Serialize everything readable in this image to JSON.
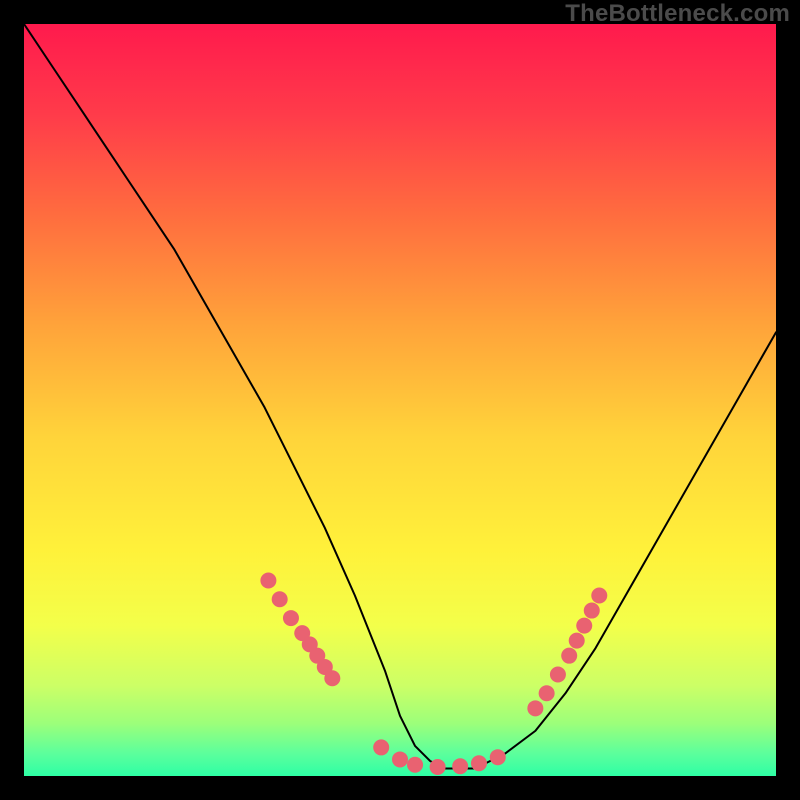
{
  "watermark": "TheBottleneck.com",
  "gradient": {
    "stops": [
      {
        "offset": 0.0,
        "color": "#ff1a4d"
      },
      {
        "offset": 0.12,
        "color": "#ff3b4a"
      },
      {
        "offset": 0.25,
        "color": "#ff6b3f"
      },
      {
        "offset": 0.4,
        "color": "#ffa33a"
      },
      {
        "offset": 0.55,
        "color": "#ffd43a"
      },
      {
        "offset": 0.7,
        "color": "#fff13a"
      },
      {
        "offset": 0.8,
        "color": "#f3ff4a"
      },
      {
        "offset": 0.88,
        "color": "#ccff66"
      },
      {
        "offset": 0.93,
        "color": "#9cff7a"
      },
      {
        "offset": 0.97,
        "color": "#5cff9c"
      },
      {
        "offset": 1.0,
        "color": "#2effa5"
      }
    ]
  },
  "chart_data": {
    "type": "line",
    "title": "",
    "xlabel": "",
    "ylabel": "",
    "xlim": [
      0,
      100
    ],
    "ylim": [
      0,
      100
    ],
    "series": [
      {
        "name": "bottleneck-curve",
        "x": [
          0,
          4,
          8,
          12,
          16,
          20,
          24,
          28,
          32,
          36,
          40,
          44,
          48,
          50,
          52,
          54,
          56,
          58,
          60,
          62,
          64,
          68,
          72,
          76,
          80,
          84,
          88,
          92,
          96,
          100
        ],
        "y": [
          100,
          94,
          88,
          82,
          76,
          70,
          63,
          56,
          49,
          41,
          33,
          24,
          14,
          8,
          4,
          2,
          1,
          1,
          1,
          2,
          3,
          6,
          11,
          17,
          24,
          31,
          38,
          45,
          52,
          59
        ]
      }
    ],
    "marker_clusters": [
      {
        "name": "left-descent-dots",
        "x": [
          32.5,
          34.0,
          35.5,
          37.0,
          38.0,
          39.0,
          40.0,
          41.0
        ],
        "y": [
          26.0,
          23.5,
          21.0,
          19.0,
          17.5,
          16.0,
          14.5,
          13.0
        ]
      },
      {
        "name": "valley-dots",
        "x": [
          47.5,
          50.0,
          52.0,
          55.0,
          58.0,
          60.5,
          63.0
        ],
        "y": [
          3.8,
          2.2,
          1.5,
          1.2,
          1.3,
          1.7,
          2.5
        ]
      },
      {
        "name": "right-ascent-dots",
        "x": [
          68.0,
          69.5,
          71.0,
          72.5,
          73.5,
          74.5,
          75.5,
          76.5
        ],
        "y": [
          9.0,
          11.0,
          13.5,
          16.0,
          18.0,
          20.0,
          22.0,
          24.0
        ]
      }
    ],
    "marker_color": "#e96271",
    "marker_radius": 8,
    "line_color": "#000000",
    "line_width": 2
  }
}
